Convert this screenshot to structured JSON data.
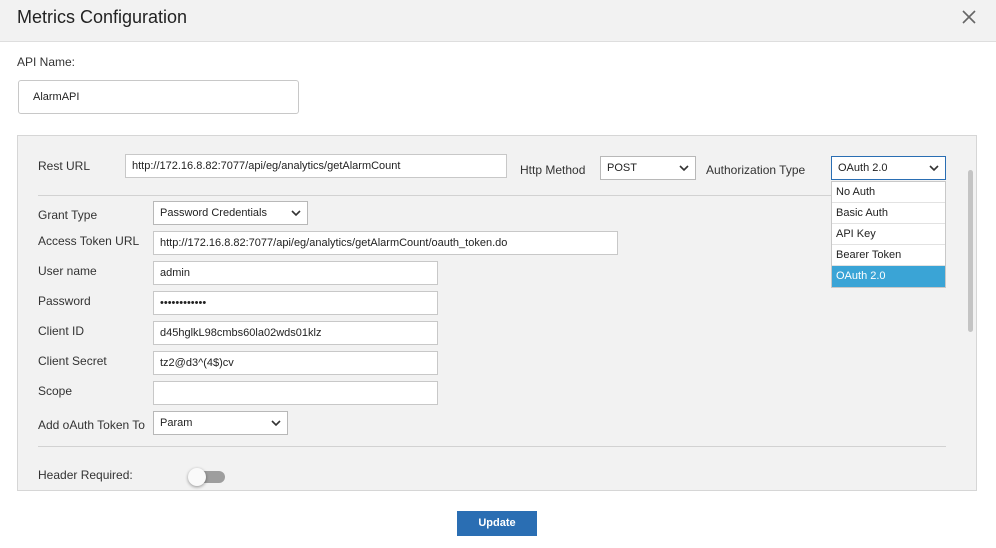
{
  "dialog": {
    "title": "Metrics Configuration"
  },
  "api_name": {
    "label": "API Name:",
    "value": "AlarmAPI"
  },
  "rest": {
    "url_label": "Rest URL",
    "url_value": "http://172.16.8.82:7077/api/eg/analytics/getAlarmCount",
    "method_label": "Http Method",
    "method_value": "POST",
    "auth_label": "Authorization Type",
    "auth_value": "OAuth 2.0",
    "auth_options": [
      "No Auth",
      "Basic Auth",
      "API Key",
      "Bearer Token",
      "OAuth 2.0"
    ]
  },
  "oauth": {
    "grant_type_label": "Grant Type",
    "grant_type_value": "Password Credentials",
    "access_token_url_label": "Access Token URL",
    "access_token_url_value": "http://172.16.8.82:7077/api/eg/analytics/getAlarmCount/oauth_token.do",
    "username_label": "User name",
    "username_value": "admin",
    "password_label": "Password",
    "password_value": "••••••••••••",
    "client_id_label": "Client ID",
    "client_id_value": "d45hglkL98cmbs60la02wds01klz",
    "client_secret_label": "Client Secret",
    "client_secret_value": "tz2@d3^(4$)cv",
    "scope_label": "Scope",
    "scope_value": "",
    "add_token_label": "Add oAuth Token To",
    "add_token_value": "Param"
  },
  "header": {
    "required_label": "Header Required:",
    "required_on": false
  },
  "actions": {
    "update_label": "Update"
  },
  "colors": {
    "accent": "#2a6eb3",
    "selected_option": "#3aa4d6",
    "header_bg": "#f2f2f2"
  },
  "icons": {
    "close": "close-icon",
    "chevron": "chevron-down-icon"
  }
}
